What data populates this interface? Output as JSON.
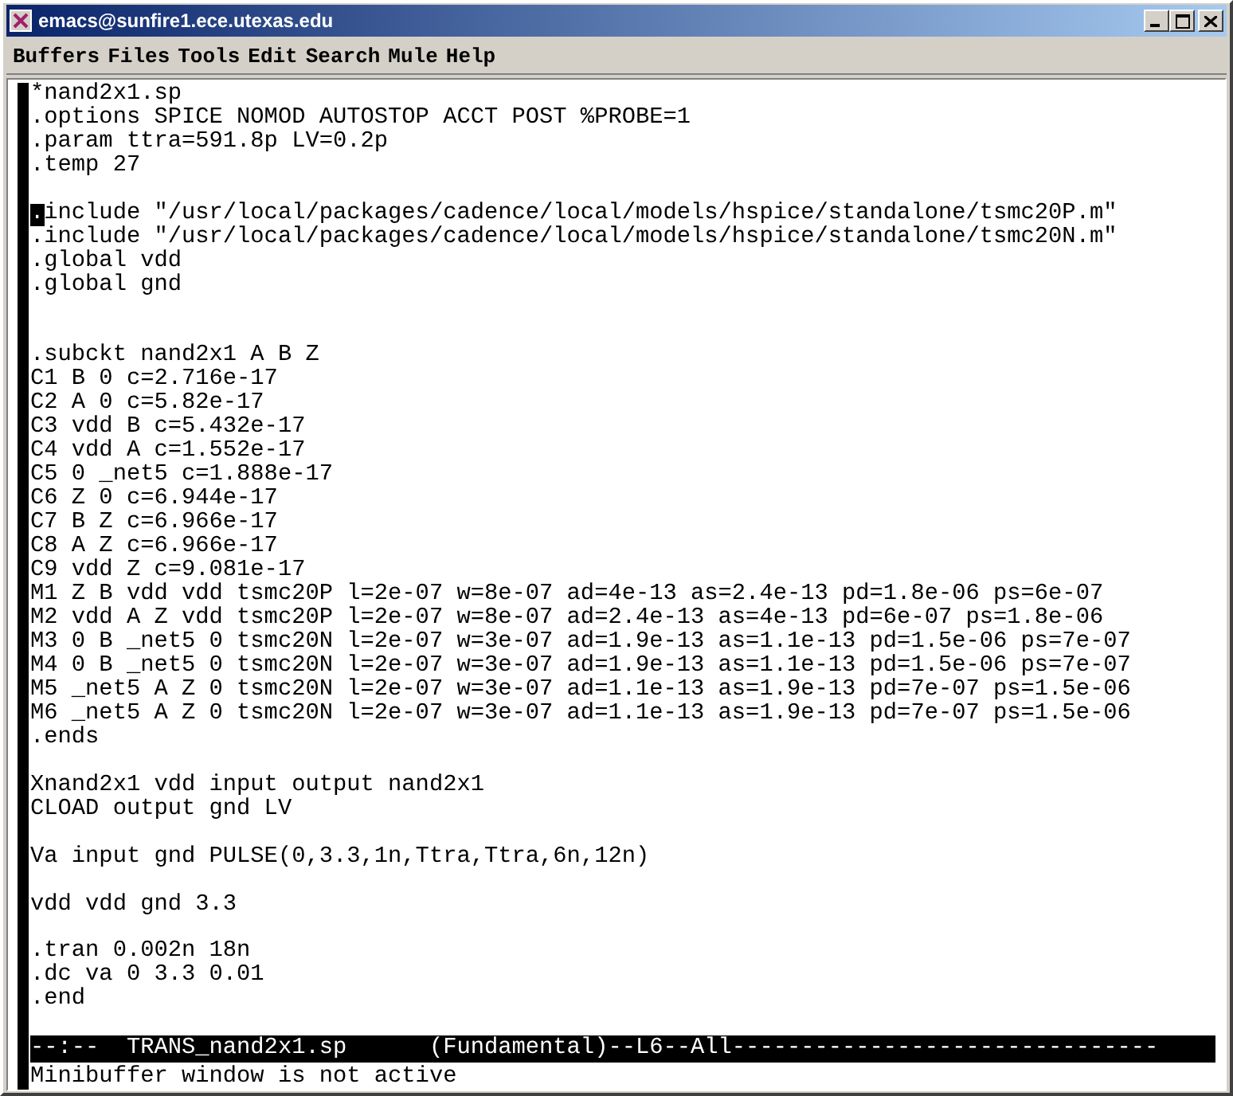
{
  "window": {
    "title": "emacs@sunfire1.ece.utexas.edu"
  },
  "menu": [
    "Buffers",
    "Files",
    "Tools",
    "Edit",
    "Search",
    "Mule",
    "Help"
  ],
  "buffer": {
    "lines": [
      {
        "kind": "text",
        "text": "*nand2x1.sp",
        "cursor": false
      },
      {
        "kind": "text",
        "text": ".options SPICE NOMOD AUTOSTOP ACCT POST %PROBE=1",
        "cursor": false
      },
      {
        "kind": "text",
        "text": ".param ttra=591.8p LV=0.2p",
        "cursor": false
      },
      {
        "kind": "text",
        "text": ".temp 27",
        "cursor": false
      },
      {
        "kind": "blank"
      },
      {
        "kind": "text",
        "text": ".include \"/usr/local/packages/cadence/local/models/hspice/standalone/tsmc20P.m\"",
        "cursor": true
      },
      {
        "kind": "text",
        "text": ".include \"/usr/local/packages/cadence/local/models/hspice/standalone/tsmc20N.m\"",
        "cursor": false
      },
      {
        "kind": "text",
        "text": ".global vdd",
        "cursor": false
      },
      {
        "kind": "text",
        "text": ".global gnd",
        "cursor": false
      },
      {
        "kind": "blank"
      },
      {
        "kind": "blank"
      },
      {
        "kind": "text",
        "text": ".subckt nand2x1 A B Z",
        "cursor": false
      },
      {
        "kind": "text",
        "text": "C1 B 0 c=2.716e-17",
        "cursor": false
      },
      {
        "kind": "text",
        "text": "C2 A 0 c=5.82e-17",
        "cursor": false
      },
      {
        "kind": "text",
        "text": "C3 vdd B c=5.432e-17",
        "cursor": false
      },
      {
        "kind": "text",
        "text": "C4 vdd A c=1.552e-17",
        "cursor": false
      },
      {
        "kind": "text",
        "text": "C5 0 _net5 c=1.888e-17",
        "cursor": false
      },
      {
        "kind": "text",
        "text": "C6 Z 0 c=6.944e-17",
        "cursor": false
      },
      {
        "kind": "text",
        "text": "C7 B Z c=6.966e-17",
        "cursor": false
      },
      {
        "kind": "text",
        "text": "C8 A Z c=6.966e-17",
        "cursor": false
      },
      {
        "kind": "text",
        "text": "C9 vdd Z c=9.081e-17",
        "cursor": false
      },
      {
        "kind": "text",
        "text": "M1 Z B vdd vdd tsmc20P l=2e-07 w=8e-07 ad=4e-13 as=2.4e-13 pd=1.8e-06 ps=6e-07",
        "cursor": false
      },
      {
        "kind": "text",
        "text": "M2 vdd A Z vdd tsmc20P l=2e-07 w=8e-07 ad=2.4e-13 as=4e-13 pd=6e-07 ps=1.8e-06",
        "cursor": false
      },
      {
        "kind": "text",
        "text": "M3 0 B _net5 0 tsmc20N l=2e-07 w=3e-07 ad=1.9e-13 as=1.1e-13 pd=1.5e-06 ps=7e-07",
        "cursor": false
      },
      {
        "kind": "text",
        "text": "M4 0 B _net5 0 tsmc20N l=2e-07 w=3e-07 ad=1.9e-13 as=1.1e-13 pd=1.5e-06 ps=7e-07",
        "cursor": false
      },
      {
        "kind": "text",
        "text": "M5 _net5 A Z 0 tsmc20N l=2e-07 w=3e-07 ad=1.1e-13 as=1.9e-13 pd=7e-07 ps=1.5e-06",
        "cursor": false
      },
      {
        "kind": "text",
        "text": "M6 _net5 A Z 0 tsmc20N l=2e-07 w=3e-07 ad=1.1e-13 as=1.9e-13 pd=7e-07 ps=1.5e-06",
        "cursor": false
      },
      {
        "kind": "text",
        "text": ".ends",
        "cursor": false
      },
      {
        "kind": "blank"
      },
      {
        "kind": "text",
        "text": "Xnand2x1 vdd input output nand2x1",
        "cursor": false
      },
      {
        "kind": "text",
        "text": "CLOAD output gnd LV",
        "cursor": false
      },
      {
        "kind": "blank"
      },
      {
        "kind": "text",
        "text": "Va input gnd PULSE(0,3.3,1n,Ttra,Ttra,6n,12n)",
        "cursor": false
      },
      {
        "kind": "blank"
      },
      {
        "kind": "text",
        "text": "vdd vdd gnd 3.3",
        "cursor": false
      },
      {
        "kind": "blank"
      },
      {
        "kind": "text",
        "text": ".tran 0.002n 18n",
        "cursor": false
      },
      {
        "kind": "text",
        "text": ".dc va 0 3.3 0.01",
        "cursor": false
      },
      {
        "kind": "text",
        "text": ".end",
        "cursor": false
      },
      {
        "kind": "blank"
      }
    ]
  },
  "mode_line": "--:--  TRANS_nand2x1.sp      (Fundamental)--L6--All-------------------------------",
  "minibuffer": "Minibuffer window is not active"
}
